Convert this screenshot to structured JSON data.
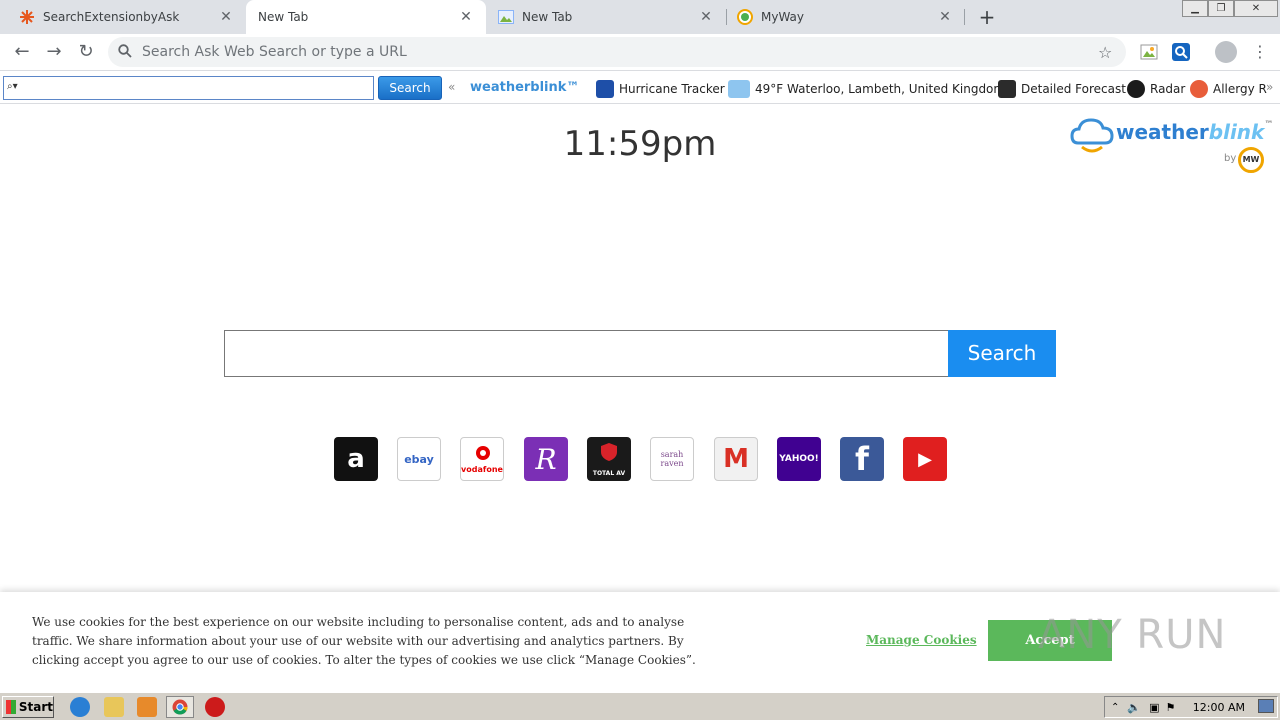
{
  "browser": {
    "tabs": [
      {
        "title": "SearchExtensionbyAsk",
        "icon": "ask-favicon",
        "active": false
      },
      {
        "title": "New Tab",
        "icon": "",
        "active": true
      },
      {
        "title": "New Tab",
        "icon": "image-favicon",
        "active": false
      },
      {
        "title": "MyWay",
        "icon": "myway-favicon",
        "active": false
      }
    ],
    "new_tab_label": "+",
    "omnibox_placeholder": "Search Ask Web Search or type a URL"
  },
  "ask_toolbar": {
    "search_label": "Search",
    "collapse_label": "«",
    "brand": "weatherblink™",
    "links": [
      {
        "label": "Hurricane Tracker",
        "icon": "hurricane-icon"
      },
      {
        "label": "49°F Waterloo, Lambeth, United Kingdom",
        "icon": "weather-cloud-icon"
      },
      {
        "label": "Detailed Forecast",
        "icon": "forecast-icon"
      },
      {
        "label": "Radar",
        "icon": "radar-icon"
      },
      {
        "label": "Allergy R",
        "icon": "allergy-icon"
      }
    ],
    "more_label": "»"
  },
  "page": {
    "time": "11:59pm",
    "logo": {
      "word1": "weather",
      "word2": "blink",
      "tm": "™",
      "by": "by",
      "mw": "MW"
    },
    "search_button": "Search",
    "tiles": [
      {
        "name": "amazon",
        "label": "a",
        "color": "#111111"
      },
      {
        "name": "ebay",
        "label": "ebay",
        "color": "#ffffff"
      },
      {
        "name": "vodafone",
        "label": "vodafone",
        "color": "#ffffff"
      },
      {
        "name": "r",
        "label": "R",
        "color": "#7b2fb5"
      },
      {
        "name": "totalav",
        "label": "TOTAL AV",
        "color": "#1a1a1a"
      },
      {
        "name": "sarah-raven",
        "label": "sarah raven",
        "color": "#ffffff"
      },
      {
        "name": "gmail",
        "label": "M",
        "color": "#f1f1f1"
      },
      {
        "name": "yahoo",
        "label": "YAHOO!",
        "color": "#400191"
      },
      {
        "name": "facebook",
        "label": "f",
        "color": "#3b5998"
      },
      {
        "name": "youtube",
        "label": "▶",
        "color": "#e01f1f"
      }
    ]
  },
  "cookie": {
    "text": "We use cookies for the best experience on our website including to personalise content, ads and to analyse traffic. We share information about your use of our website with our advertising and analytics partners. By clicking accept you agree to our use of cookies. To alter the types of cookies we use click “Manage Cookies”.",
    "manage_label": "Manage Cookies",
    "accept_label": "Accept"
  },
  "watermark": "ANY RUN",
  "taskbar": {
    "start_label": "Start",
    "clock": "12:00 AM"
  }
}
